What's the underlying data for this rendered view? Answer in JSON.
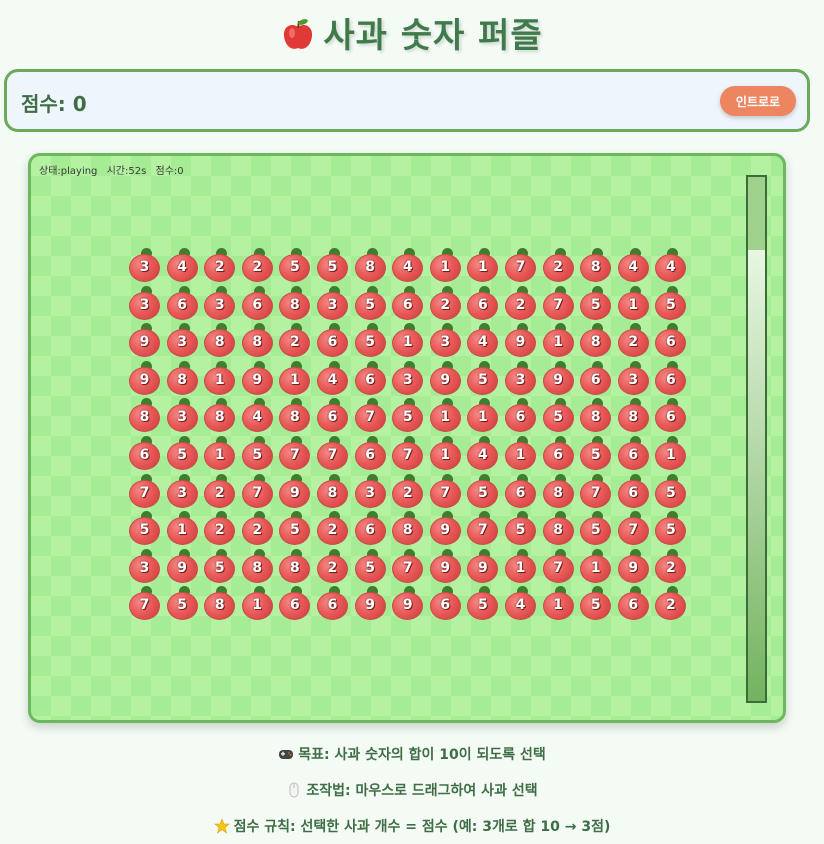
{
  "header": {
    "title": "사과 숫자 퍼즐",
    "title_icon": "apple-icon"
  },
  "score_panel": {
    "score_text": "점수: 0",
    "intro_button_label": "인트로로"
  },
  "board": {
    "status": {
      "state": "상태:playing",
      "time": "시간:52s",
      "score": "점수:0"
    },
    "timer_remaining_fraction": 0.86,
    "grid": [
      [
        3,
        4,
        2,
        2,
        5,
        5,
        8,
        4,
        1,
        1,
        7,
        2,
        8,
        4,
        4
      ],
      [
        3,
        6,
        3,
        6,
        8,
        3,
        5,
        6,
        2,
        6,
        2,
        7,
        5,
        1,
        5
      ],
      [
        9,
        3,
        8,
        8,
        2,
        6,
        5,
        1,
        3,
        4,
        9,
        1,
        8,
        2,
        6
      ],
      [
        9,
        8,
        1,
        9,
        1,
        4,
        6,
        3,
        9,
        5,
        3,
        9,
        6,
        3,
        6
      ],
      [
        8,
        3,
        8,
        4,
        8,
        6,
        7,
        5,
        1,
        1,
        6,
        5,
        8,
        8,
        6
      ],
      [
        6,
        5,
        1,
        5,
        7,
        7,
        6,
        7,
        1,
        4,
        1,
        6,
        5,
        6,
        1
      ],
      [
        7,
        3,
        2,
        7,
        9,
        8,
        3,
        2,
        7,
        5,
        6,
        8,
        7,
        6,
        5
      ],
      [
        5,
        1,
        2,
        2,
        5,
        2,
        6,
        8,
        9,
        7,
        5,
        8,
        5,
        7,
        5
      ],
      [
        3,
        9,
        5,
        8,
        8,
        2,
        5,
        7,
        9,
        9,
        1,
        7,
        1,
        9,
        2
      ],
      [
        7,
        5,
        8,
        1,
        6,
        6,
        9,
        9,
        6,
        5,
        4,
        1,
        5,
        6,
        2
      ]
    ],
    "colors": {
      "apple": "#e85a58",
      "leaf": "#3f7e2e",
      "board_bg": "#b4f2a2",
      "border": "#6cb85e"
    }
  },
  "instructions": {
    "goal": "목표: 사과 숫자의 합이 10이 되도록 선택",
    "goal_icon": "gamepad-icon",
    "controls": "조작법: 마우스로 드래그하여 사과 선택",
    "controls_icon": "mouse-icon",
    "scoring": "점수 규칙: 선택한 사과 개수 = 점수 (예: 3개로 합 10 → 3점)",
    "scoring_icon": "star-icon"
  }
}
